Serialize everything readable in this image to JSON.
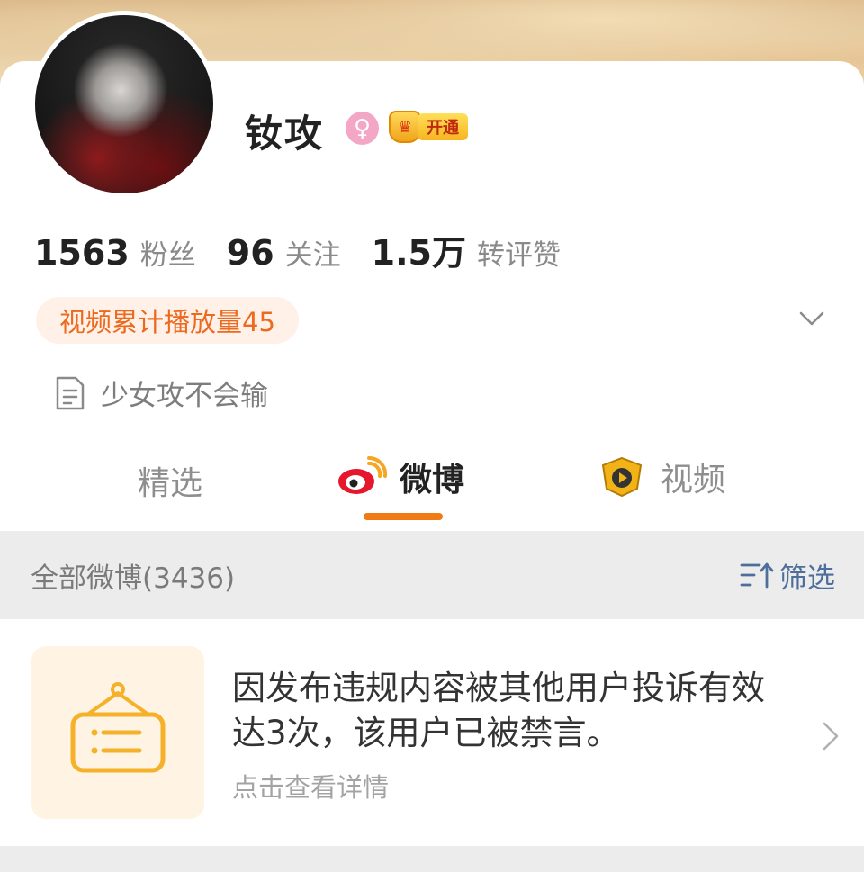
{
  "profile": {
    "name": "钕攻",
    "gender_icon": "female-icon",
    "vip_label": "开通"
  },
  "stats": [
    {
      "value": "1563",
      "label": "粉丝"
    },
    {
      "value": "96",
      "label": "关注"
    },
    {
      "value": "1.5万",
      "label": "转评赞"
    }
  ],
  "play_badge": "视频累计播放量45",
  "bio": "少女攻不会输",
  "tabs": [
    {
      "label": "精选"
    },
    {
      "label": "微博"
    },
    {
      "label": "视频"
    }
  ],
  "filter_bar": {
    "title": "全部微博(3436)",
    "filter_label": "筛选"
  },
  "notice": {
    "text": "因发布违规内容被其他用户投诉有效达3次，该用户已被禁言。",
    "sub": "点击查看详情"
  },
  "colors": {
    "accent": "#f07a14",
    "link": "#4e6f9b",
    "badge_text": "#ec6a20"
  }
}
